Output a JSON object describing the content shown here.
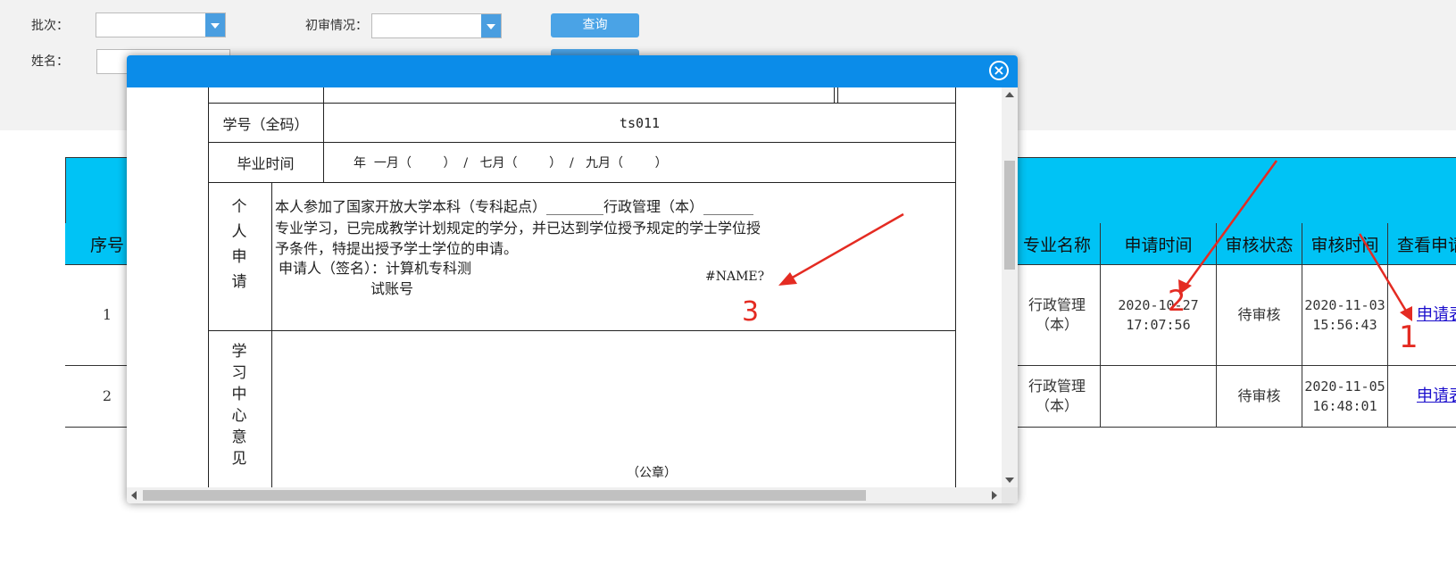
{
  "filters": {
    "batch_label": "批次：",
    "batch_value": "",
    "review_label": "初审情况：",
    "review_value": "",
    "name_label": "姓名：",
    "name_value": "",
    "query_button": "查询"
  },
  "table": {
    "headers": [
      "序号",
      "专业名称",
      "申请时间",
      "审核状态",
      "审核时间",
      "查看申请"
    ],
    "rows": [
      {
        "index": "1",
        "major": "行政管理（本）",
        "apply_time": "2020-10-27 17:07:56",
        "status": "待审核",
        "review_time": "2020-11-03 15:56:43",
        "link": "申请表"
      },
      {
        "index": "2",
        "major": "行政管理（本）",
        "apply_time": "",
        "status": "待审核",
        "review_time": "2020-11-05 16:48:01",
        "link": "申请表"
      }
    ]
  },
  "modal": {
    "close_icon": "close-circle-icon",
    "student_id_label": "学号（全码）",
    "student_id_value": "ts011",
    "grad_label": "毕业时间",
    "grad_value": "年  一月（        ）  /   七月（        ）  /   九月（        ）",
    "personal_label": "个人申请",
    "statement_line1": "本人参加了国家开放大学本科（专科起点）________行政管理（本）_______",
    "statement_line2": "专业学习，已完成教学计划规定的学分，并已达到学位授予规定的学士学位授",
    "statement_line3": "予条件，特提出授予学士学位的申请。",
    "signer_label": "申请人（签名）：计算机专科测",
    "signer_label2": "试账号",
    "name_error": "#NAME?",
    "center_label": "学习中心意见",
    "seal": "（公章）"
  },
  "annotations": {
    "a1": "1",
    "a2": "2",
    "a3": "3",
    "color": "#e42b22"
  }
}
